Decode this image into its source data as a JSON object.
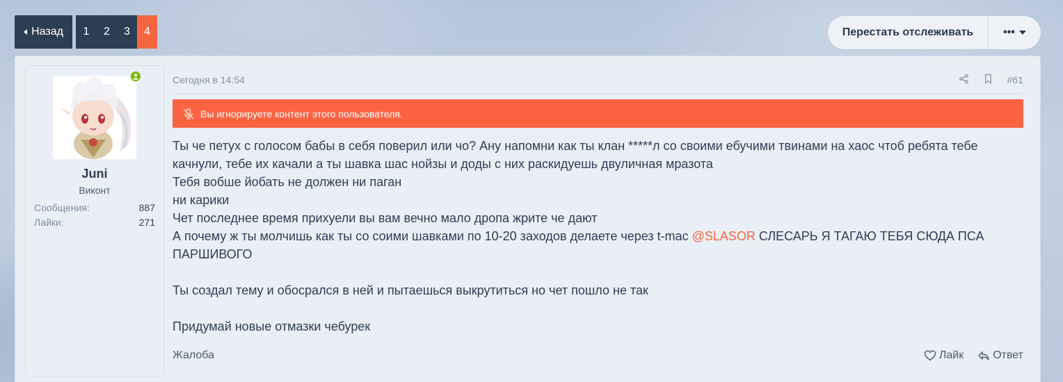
{
  "pagination": {
    "back_label": "Назад",
    "pages": [
      "1",
      "2",
      "3",
      "4"
    ],
    "active_page": "4"
  },
  "thread_actions": {
    "unwatch_label": "Перестать отслеживать",
    "more_label": "•••"
  },
  "user": {
    "name": "Juni",
    "title": "Виконт",
    "stats": [
      {
        "label": "Сообщения:",
        "value": "887"
      },
      {
        "label": "Лайки:",
        "value": "271"
      }
    ]
  },
  "post": {
    "date": "Сегодня в 14:54",
    "number": "#61",
    "ignore_notice": "Вы игнорируете контент этого пользователя.",
    "lines": [
      "Ты че петух с голосом бабы в себя поверил или чо? Ану напомни как ты клан *****л со своими ебучими твинами на хаос чтоб ребята тебе качнули, тебе их качали а ты шавка шас нойзы и доды с них раскидуешь двуличная мразота",
      "Тебя вобше йобать не должен ни паган",
      "ни карики",
      "Чет последнее время прихуели вы вам вечно мало дропа жрите че дают"
    ],
    "mention_line_prefix": "А почему ж ты молчишь как ты со соими шавками по 10-20 заходов делаете через t-mac ",
    "mention": "@SLASOR",
    "mention_line_suffix": " СЛЕСАРЬ Я ТАГАЮ ТЕБЯ СЮДА ПСА ПАРШИВОГО",
    "line_after_1": "Ты создал тему и обосрался в ней и пытаешься выкрутиться но чет пошло не так",
    "line_after_2": "Придумай новые отмазки чебурек"
  },
  "footer": {
    "report_label": "Жалоба",
    "like_label": "Лайк",
    "reply_label": "Ответ"
  },
  "colors": {
    "accent": "#f4663f",
    "banner": "#fa6443",
    "nav_dark": "#2d3e52",
    "online": "#7fba00"
  }
}
